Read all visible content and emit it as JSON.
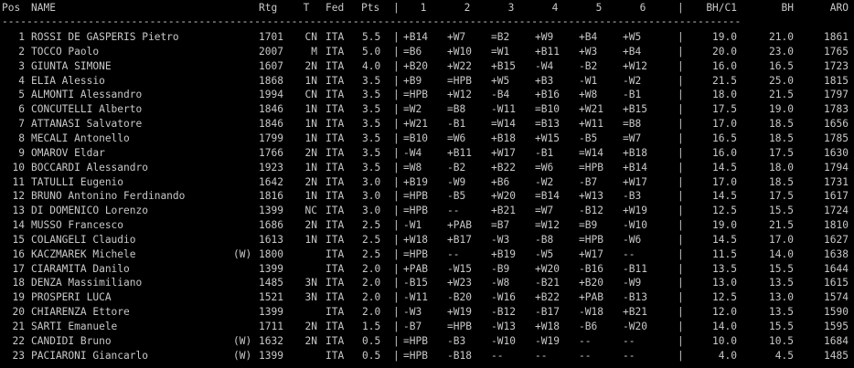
{
  "colors": {
    "background": "#000000",
    "text": "#c8c8c8"
  },
  "header": {
    "pos": "Pos",
    "name": "NAME",
    "rtg": "Rtg",
    "t": "T",
    "fed": "Fed",
    "pts": "Pts",
    "bar1": "|",
    "r1": "1",
    "r2": "2",
    "r3": "3",
    "r4": "4",
    "r5": "5",
    "r6": "6",
    "bar2": "|",
    "bhc1": "BH/C1",
    "bh": "BH",
    "aro": "ARO"
  },
  "separator": "------------------------------------------------------------------------------------------------------------------------",
  "rows": [
    {
      "pos": "1",
      "name": "ROSSI DE GASPERIS Pietro",
      "w": "",
      "rtg": "1701",
      "t": "CN",
      "fed": "ITA",
      "pts": "5.5",
      "bar1": "|",
      "r1": "+B14",
      "r2": "+W7",
      "r3": "=B2",
      "r4": "+W9",
      "r5": "+B4",
      "r6": "+W5",
      "bar2": "|",
      "bhc1": "19.0",
      "bh": "21.0",
      "aro": "1861"
    },
    {
      "pos": "2",
      "name": "TOCCO Paolo",
      "w": "",
      "rtg": "2007",
      "t": "M",
      "fed": "ITA",
      "pts": "5.0",
      "bar1": "|",
      "r1": "=B6",
      "r2": "+W10",
      "r3": "=W1",
      "r4": "+B11",
      "r5": "+W3",
      "r6": "+B4",
      "bar2": "|",
      "bhc1": "20.0",
      "bh": "23.0",
      "aro": "1765"
    },
    {
      "pos": "3",
      "name": "GIUNTA SIMONE",
      "w": "",
      "rtg": "1607",
      "t": "2N",
      "fed": "ITA",
      "pts": "4.0",
      "bar1": "|",
      "r1": "+B20",
      "r2": "+W22",
      "r3": "+B15",
      "r4": "-W4",
      "r5": "-B2",
      "r6": "+W12",
      "bar2": "|",
      "bhc1": "16.0",
      "bh": "16.5",
      "aro": "1723"
    },
    {
      "pos": "4",
      "name": "ELIA Alessio",
      "w": "",
      "rtg": "1868",
      "t": "1N",
      "fed": "ITA",
      "pts": "3.5",
      "bar1": "|",
      "r1": "+B9",
      "r2": "=HPB",
      "r3": "+W5",
      "r4": "+B3",
      "r5": "-W1",
      "r6": "-W2",
      "bar2": "|",
      "bhc1": "21.5",
      "bh": "25.0",
      "aro": "1815"
    },
    {
      "pos": "5",
      "name": "ALMONTI Alessandro",
      "w": "",
      "rtg": "1994",
      "t": "CN",
      "fed": "ITA",
      "pts": "3.5",
      "bar1": "|",
      "r1": "=HPB",
      "r2": "+W12",
      "r3": "-B4",
      "r4": "+B16",
      "r5": "+W8",
      "r6": "-B1",
      "bar2": "|",
      "bhc1": "18.0",
      "bh": "21.5",
      "aro": "1797"
    },
    {
      "pos": "6",
      "name": "CONCUTELLI Alberto",
      "w": "",
      "rtg": "1846",
      "t": "1N",
      "fed": "ITA",
      "pts": "3.5",
      "bar1": "|",
      "r1": "=W2",
      "r2": "=B8",
      "r3": "-W11",
      "r4": "=B10",
      "r5": "+W21",
      "r6": "+B15",
      "bar2": "|",
      "bhc1": "17.5",
      "bh": "19.0",
      "aro": "1783"
    },
    {
      "pos": "7",
      "name": "ATTANASI Salvatore",
      "w": "",
      "rtg": "1846",
      "t": "1N",
      "fed": "ITA",
      "pts": "3.5",
      "bar1": "|",
      "r1": "+W21",
      "r2": "-B1",
      "r3": "=W14",
      "r4": "=B13",
      "r5": "+W11",
      "r6": "=B8",
      "bar2": "|",
      "bhc1": "17.0",
      "bh": "18.5",
      "aro": "1656"
    },
    {
      "pos": "8",
      "name": "MECALI Antonello",
      "w": "",
      "rtg": "1799",
      "t": "1N",
      "fed": "ITA",
      "pts": "3.5",
      "bar1": "|",
      "r1": "=B10",
      "r2": "=W6",
      "r3": "+B18",
      "r4": "+W15",
      "r5": "-B5",
      "r6": "=W7",
      "bar2": "|",
      "bhc1": "16.5",
      "bh": "18.5",
      "aro": "1785"
    },
    {
      "pos": "9",
      "name": "OMAROV Eldar",
      "w": "",
      "rtg": "1766",
      "t": "2N",
      "fed": "ITA",
      "pts": "3.5",
      "bar1": "|",
      "r1": "-W4",
      "r2": "+B11",
      "r3": "+W17",
      "r4": "-B1",
      "r5": "=W14",
      "r6": "+B18",
      "bar2": "|",
      "bhc1": "16.0",
      "bh": "17.5",
      "aro": "1630"
    },
    {
      "pos": "10",
      "name": "BOCCARDI Alessandro",
      "w": "",
      "rtg": "1923",
      "t": "1N",
      "fed": "ITA",
      "pts": "3.5",
      "bar1": "|",
      "r1": "=W8",
      "r2": "-B2",
      "r3": "+B22",
      "r4": "=W6",
      "r5": "=HPB",
      "r6": "+B14",
      "bar2": "|",
      "bhc1": "14.5",
      "bh": "18.0",
      "aro": "1794"
    },
    {
      "pos": "11",
      "name": "TATULLI Eugenio",
      "w": "",
      "rtg": "1642",
      "t": "2N",
      "fed": "ITA",
      "pts": "3.0",
      "bar1": "|",
      "r1": "+B19",
      "r2": "-W9",
      "r3": "+B6",
      "r4": "-W2",
      "r5": "-B7",
      "r6": "+W17",
      "bar2": "|",
      "bhc1": "17.0",
      "bh": "18.5",
      "aro": "1731"
    },
    {
      "pos": "12",
      "name": "BRUNO Antonino Ferdinando",
      "w": "",
      "rtg": "1816",
      "t": "1N",
      "fed": "ITA",
      "pts": "3.0",
      "bar1": "|",
      "r1": "=HPB",
      "r2": "-B5",
      "r3": "+W20",
      "r4": "=B14",
      "r5": "+W13",
      "r6": "-B3",
      "bar2": "|",
      "bhc1": "14.5",
      "bh": "17.5",
      "aro": "1617"
    },
    {
      "pos": "13",
      "name": "DI DOMENICO Lorenzo",
      "w": "",
      "rtg": "1399",
      "t": "NC",
      "fed": "ITA",
      "pts": "3.0",
      "bar1": "|",
      "r1": "=HPB",
      "r2": "--",
      "r3": "+B21",
      "r4": "=W7",
      "r5": "-B12",
      "r6": "+W19",
      "bar2": "|",
      "bhc1": "12.5",
      "bh": "15.5",
      "aro": "1724"
    },
    {
      "pos": "14",
      "name": "MUSSO Francesco",
      "w": "",
      "rtg": "1686",
      "t": "2N",
      "fed": "ITA",
      "pts": "2.5",
      "bar1": "|",
      "r1": "-W1",
      "r2": "+PAB",
      "r3": "=B7",
      "r4": "=W12",
      "r5": "=B9",
      "r6": "-W10",
      "bar2": "|",
      "bhc1": "19.0",
      "bh": "21.5",
      "aro": "1810"
    },
    {
      "pos": "15",
      "name": "COLANGELI Claudio",
      "w": "",
      "rtg": "1613",
      "t": "1N",
      "fed": "ITA",
      "pts": "2.5",
      "bar1": "|",
      "r1": "+W18",
      "r2": "+B17",
      "r3": "-W3",
      "r4": "-B8",
      "r5": "=HPB",
      "r6": "-W6",
      "bar2": "|",
      "bhc1": "14.5",
      "bh": "17.0",
      "aro": "1627"
    },
    {
      "pos": "16",
      "name": "KACZMAREK Michele",
      "w": "(W)",
      "rtg": "1800",
      "t": "",
      "fed": "ITA",
      "pts": "2.5",
      "bar1": "|",
      "r1": "=HPB",
      "r2": "--",
      "r3": "+B19",
      "r4": "-W5",
      "r5": "+W17",
      "r6": "--",
      "bar2": "|",
      "bhc1": "11.5",
      "bh": "14.0",
      "aro": "1638"
    },
    {
      "pos": "17",
      "name": "CIARAMITA Danilo",
      "w": "",
      "rtg": "1399",
      "t": "",
      "fed": "ITA",
      "pts": "2.0",
      "bar1": "|",
      "r1": "+PAB",
      "r2": "-W15",
      "r3": "-B9",
      "r4": "+W20",
      "r5": "-B16",
      "r6": "-B11",
      "bar2": "|",
      "bhc1": "13.5",
      "bh": "15.5",
      "aro": "1644"
    },
    {
      "pos": "18",
      "name": "DENZA Massimiliano",
      "w": "",
      "rtg": "1485",
      "t": "3N",
      "fed": "ITA",
      "pts": "2.0",
      "bar1": "|",
      "r1": "-B15",
      "r2": "+W23",
      "r3": "-W8",
      "r4": "-B21",
      "r5": "+B20",
      "r6": "-W9",
      "bar2": "|",
      "bhc1": "13.0",
      "bh": "13.5",
      "aro": "1615"
    },
    {
      "pos": "19",
      "name": "PROSPERI LUCA",
      "w": "",
      "rtg": "1521",
      "t": "3N",
      "fed": "ITA",
      "pts": "2.0",
      "bar1": "|",
      "r1": "-W11",
      "r2": "-B20",
      "r3": "-W16",
      "r4": "+B22",
      "r5": "+PAB",
      "r6": "-B13",
      "bar2": "|",
      "bhc1": "12.5",
      "bh": "13.0",
      "aro": "1574"
    },
    {
      "pos": "20",
      "name": "CHIARENZA Ettore",
      "w": "",
      "rtg": "1399",
      "t": "",
      "fed": "ITA",
      "pts": "2.0",
      "bar1": "|",
      "r1": "-W3",
      "r2": "+W19",
      "r3": "-B12",
      "r4": "-B17",
      "r5": "-W18",
      "r6": "+B21",
      "bar2": "|",
      "bhc1": "12.0",
      "bh": "13.5",
      "aro": "1590"
    },
    {
      "pos": "21",
      "name": "SARTI Emanuele",
      "w": "",
      "rtg": "1711",
      "t": "2N",
      "fed": "ITA",
      "pts": "1.5",
      "bar1": "|",
      "r1": "-B7",
      "r2": "=HPB",
      "r3": "-W13",
      "r4": "+W18",
      "r5": "-B6",
      "r6": "-W20",
      "bar2": "|",
      "bhc1": "14.0",
      "bh": "15.5",
      "aro": "1595"
    },
    {
      "pos": "22",
      "name": "CANDIDI Bruno",
      "w": "(W)",
      "rtg": "1632",
      "t": "2N",
      "fed": "ITA",
      "pts": "0.5",
      "bar1": "|",
      "r1": "=HPB",
      "r2": "-B3",
      "r3": "-W10",
      "r4": "-W19",
      "r5": "--",
      "r6": "--",
      "bar2": "|",
      "bhc1": "10.0",
      "bh": "10.5",
      "aro": "1684"
    },
    {
      "pos": "23",
      "name": "PACIARONI Giancarlo",
      "w": "(W)",
      "rtg": "1399",
      "t": "",
      "fed": "ITA",
      "pts": "0.5",
      "bar1": "|",
      "r1": "=HPB",
      "r2": "-B18",
      "r3": "--",
      "r4": "--",
      "r5": "--",
      "r6": "--",
      "bar2": "|",
      "bhc1": "4.0",
      "bh": "4.5",
      "aro": "1485"
    }
  ]
}
